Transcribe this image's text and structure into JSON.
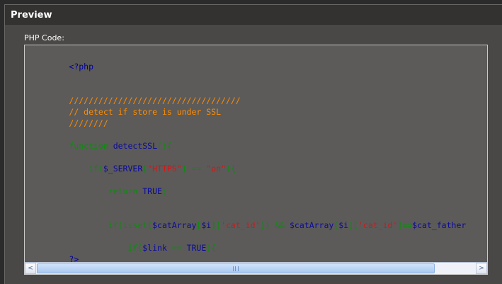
{
  "panel": {
    "title": "Preview"
  },
  "code_block": {
    "label": "PHP Code:",
    "lines": {
      "l1": "<?php",
      "l2": "///////////////////////////////////",
      "l3": "// detect if store is under SSL",
      "l4": "////////",
      "l5_a": "function",
      "l5_b": " detectSSL",
      "l5_c": "(){",
      "l6_a": "    if(",
      "l6_b": "$_SERVER",
      "l6_c": "[",
      "l6_d": "\"HTTPS\"",
      "l6_e": "] == ",
      "l6_f": "\"on\"",
      "l6_g": "){",
      "l7_a": "        return ",
      "l7_b": "TRUE",
      "l7_c": ";",
      "l8_a": "        if(isset(",
      "l8_b": "$catArray",
      "l8_c": "[",
      "l8_d": "$i",
      "l8_e": "][",
      "l8_f": "'cat_id'",
      "l8_g": "]) && ",
      "l8_h": "$catArray",
      "l8_i": "[",
      "l8_j": "$i",
      "l8_k": "][",
      "l8_l": "'cat_id'",
      "l8_m": "]==",
      "l8_n": "$cat_father",
      "l9_a": "            if(",
      "l9_b": "$link",
      "l9_c": " == ",
      "l9_d": "TRUE",
      "l9_e": "){",
      "l10": "?>"
    }
  },
  "scrollbar": {
    "left_arrow": "<",
    "right_arrow": ">"
  },
  "colors": {
    "keyword": "#118811",
    "identifier": "#0b0b9a",
    "string": "#d11818",
    "comment": "#ff8c00",
    "background": "#5c5b5a"
  }
}
